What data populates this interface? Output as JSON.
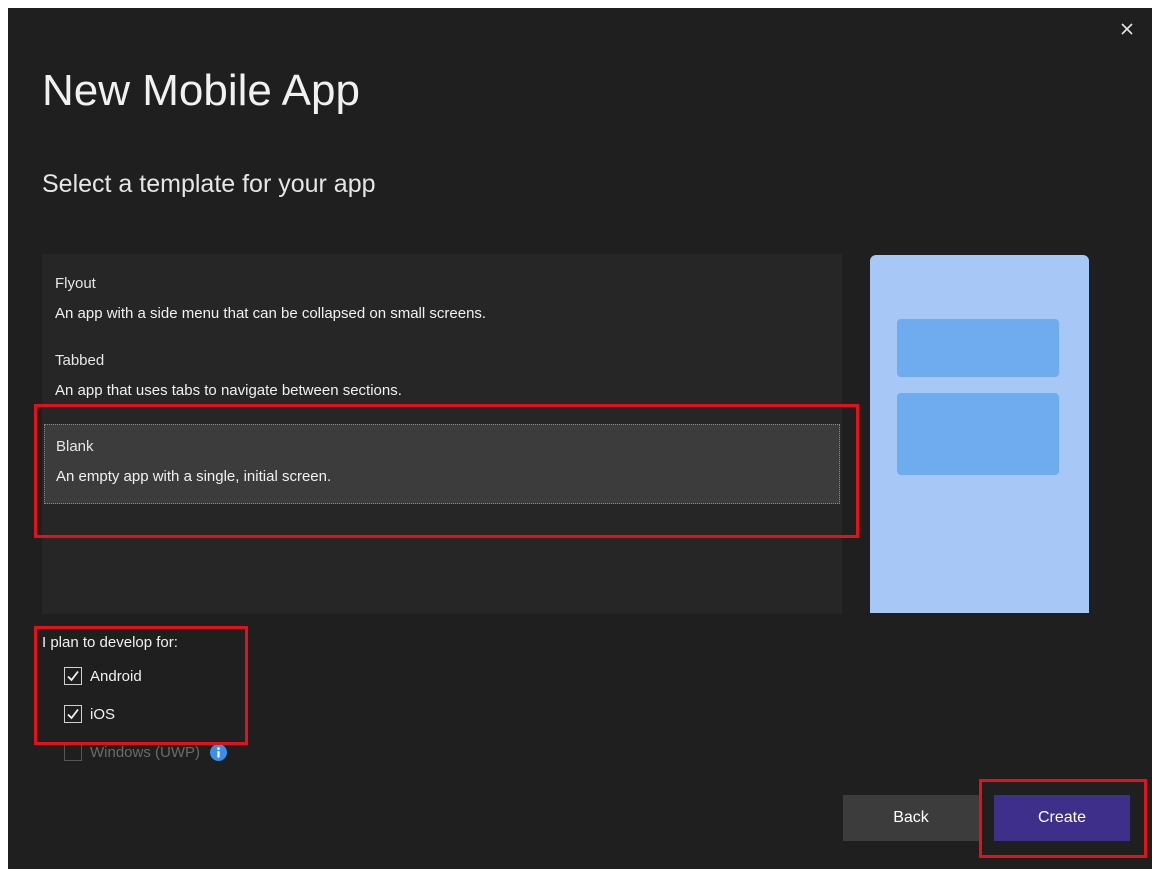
{
  "dialog": {
    "title": "New Mobile App",
    "subtitle": "Select a template for your app",
    "close_icon": "close-icon"
  },
  "templates": [
    {
      "name": "Flyout",
      "description": "An app with a side menu that can be collapsed on small screens.",
      "selected": false
    },
    {
      "name": "Tabbed",
      "description": "An app that uses tabs to navigate between sections.",
      "selected": false
    },
    {
      "name": "Blank",
      "description": "An empty app with a single, initial screen.",
      "selected": true
    }
  ],
  "platforms": {
    "label": "I plan to develop for:",
    "options": [
      {
        "label": "Android",
        "checked": true,
        "enabled": true
      },
      {
        "label": "iOS",
        "checked": true,
        "enabled": true
      },
      {
        "label": "Windows (UWP)",
        "checked": false,
        "enabled": false
      }
    ],
    "info_icon": "info-icon"
  },
  "buttons": {
    "back_label": "Back",
    "create_label": "Create"
  },
  "colors": {
    "background": "#1f1f1f",
    "list_background": "#262626",
    "selected_item": "#3c3c3c",
    "preview_background": "#a7c8f6",
    "preview_block": "#6eabef",
    "primary_button": "#3e2f8a",
    "secondary_button": "#3c3c3c",
    "annotation": "#e0121c",
    "info_icon": "#3b8eea"
  }
}
